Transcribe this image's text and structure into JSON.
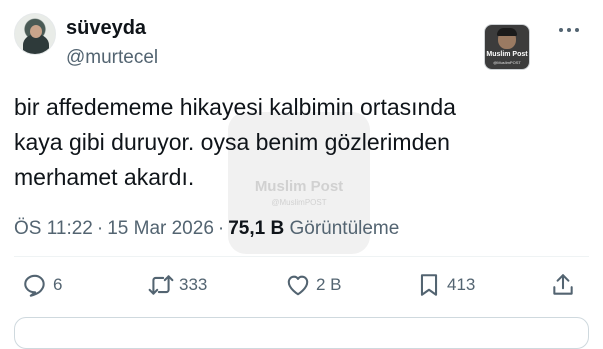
{
  "author": {
    "display_name": "süveyda",
    "handle": "@murtecel"
  },
  "brand_logo": {
    "name": "Muslim Post",
    "subtext": "@MuslimPOST"
  },
  "tweet": {
    "lines": [
      "bir affedememe hikayesi kalbimin ortasında",
      "kaya gibi duruyor. oysa benim gözlerimden",
      "merhamet akardı."
    ]
  },
  "watermark": {
    "name": "Muslim Post",
    "subtext": "@MuslimPOST"
  },
  "meta": {
    "time": "ÖS 11:22",
    "separator": "·",
    "date": "15 Mar 2026",
    "views_count": "75,1 B",
    "views_label": "Görüntüleme"
  },
  "actions": {
    "replies": "6",
    "retweets": "333",
    "likes": "2 B",
    "bookmarks": "413"
  },
  "colors": {
    "text_primary": "#0f1419",
    "text_secondary": "#536471",
    "divider": "#eff3f4"
  },
  "icons": [
    "more-icon",
    "reply-icon",
    "retweet-icon",
    "like-icon",
    "bookmark-icon",
    "share-icon"
  ]
}
